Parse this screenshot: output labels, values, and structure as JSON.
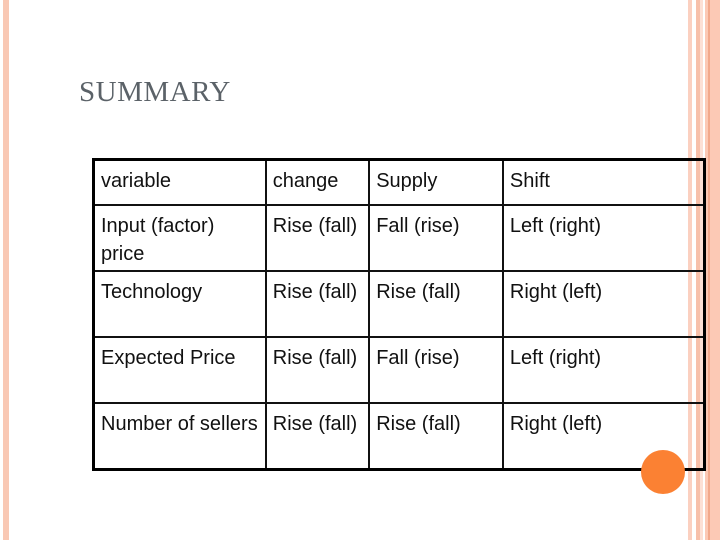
{
  "title": "SUMMARY",
  "table": {
    "headers": [
      "variable",
      "change",
      "Supply",
      "Shift"
    ],
    "rows": [
      [
        "Input (factor) price",
        "Rise (fall)",
        "Fall (rise)",
        "Left (right)"
      ],
      [
        "Technology",
        "Rise (fall)",
        "Rise (fall)",
        "Right (left)"
      ],
      [
        "Expected Price",
        "Rise (fall)",
        "Fall (rise)",
        "Left (right)"
      ],
      [
        "Number of sellers",
        "Rise (fall)",
        "Rise (fall)",
        "Right (left)"
      ]
    ]
  },
  "colors": {
    "accent": "#fb8133",
    "stripe": "#f9c8b4",
    "title": "#5b6268"
  }
}
